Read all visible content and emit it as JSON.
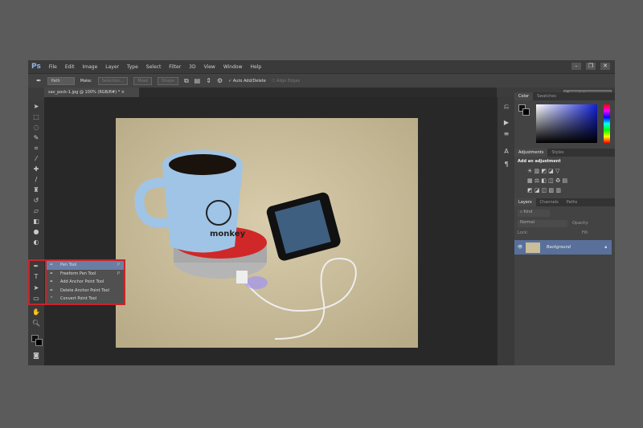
{
  "app": {
    "logo": "Ps",
    "menus": [
      "File",
      "Edit",
      "Image",
      "Layer",
      "Type",
      "Select",
      "Filter",
      "3D",
      "View",
      "Window",
      "Help"
    ]
  },
  "options": {
    "mode": "Path",
    "make_label": "Make:",
    "selection": "Selection...",
    "mask": "Mask",
    "shape": "Shape",
    "auto_add_delete": "Auto Add/Delete",
    "align_edges": "Align Edges",
    "workspace": "Essentials"
  },
  "document": {
    "tab": "sav_pock-1.jpg @ 100% (RGB/8#) *"
  },
  "flyout": [
    {
      "label": "Pen Tool",
      "key": "P",
      "selected": true
    },
    {
      "label": "Freeform Pen Tool",
      "key": "P"
    },
    {
      "label": "Add Anchor Point Tool",
      "key": ""
    },
    {
      "label": "Delete Anchor Point Tool",
      "key": ""
    },
    {
      "label": "Convert Point Tool",
      "key": ""
    }
  ],
  "panels": {
    "color_tabs": [
      "Color",
      "Swatches"
    ],
    "adjust_tabs": [
      "Adjustments",
      "Styles"
    ],
    "adjust_title": "Add an adjustment",
    "layers_tabs": [
      "Layers",
      "Channels",
      "Paths"
    ],
    "kind": "Kind",
    "blend": "Normal",
    "opacity_label": "Opacity:",
    "lock_label": "Lock:",
    "fill_label": "Fill:",
    "layer_name": "Background"
  },
  "photo": {
    "mug_text": "monkey"
  }
}
